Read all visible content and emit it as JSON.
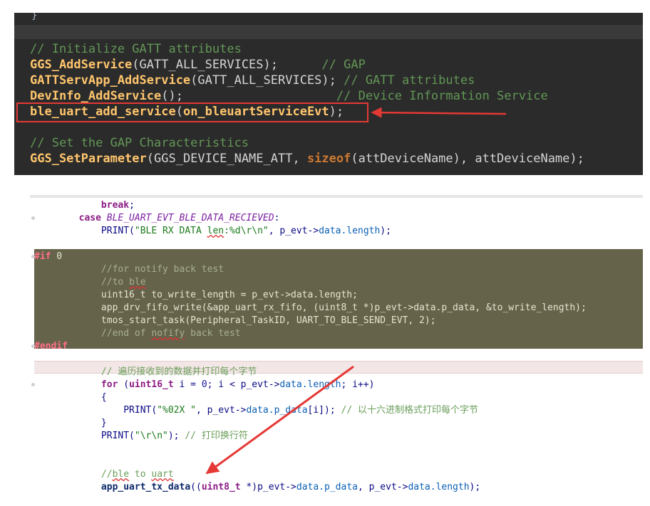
{
  "colors": {
    "highlight_red": "#e53935",
    "arrow_red": "#e53935"
  },
  "panel1": {
    "brace": "}",
    "lines": [
      {
        "segments": [
          {
            "cls": "c-comment",
            "text": "// Initialize GATT attributes"
          }
        ]
      },
      {
        "segments": [
          {
            "cls": "c-fn",
            "text": "GGS_AddService"
          },
          {
            "cls": "c-plain",
            "text": "(GATT_ALL_SERVICES);      "
          },
          {
            "cls": "c-comment",
            "text": "// GAP"
          }
        ]
      },
      {
        "segments": [
          {
            "cls": "c-fn",
            "text": "GATTServApp_AddService"
          },
          {
            "cls": "c-plain",
            "text": "(GATT_ALL_SERVICES); "
          },
          {
            "cls": "c-comment",
            "text": "// GATT attributes"
          }
        ]
      },
      {
        "segments": [
          {
            "cls": "c-fn",
            "text": "DevInfo_AddService"
          },
          {
            "cls": "c-plain",
            "text": "();                     "
          },
          {
            "cls": "c-comment",
            "text": "// Device Information Service"
          }
        ]
      },
      {
        "segments": [
          {
            "cls": "c-fn",
            "text": "ble_uart_add_service"
          },
          {
            "cls": "c-plain",
            "text": "("
          },
          {
            "cls": "c-fn",
            "text": "on_bleuartServiceEvt"
          },
          {
            "cls": "c-plain",
            "text": ");"
          }
        ]
      },
      {
        "segments": [
          {
            "cls": "c-plain",
            "text": ""
          }
        ]
      },
      {
        "segments": [
          {
            "cls": "c-comment",
            "text": "// Set the GAP Characteristics"
          }
        ]
      },
      {
        "segments": [
          {
            "cls": "c-fn",
            "text": "GGS_SetParameter"
          },
          {
            "cls": "c-plain",
            "text": "(GGS_DEVICE_NAME_ATT, "
          },
          {
            "cls": "c-kw",
            "text": "sizeof"
          },
          {
            "cls": "c-plain",
            "text": "(attDeviceName), attDeviceName);"
          }
        ]
      }
    ]
  },
  "panel2": {
    "lines": [
      {
        "dot": false,
        "segments": [
          {
            "cls": "k",
            "text": "            break"
          },
          {
            "cls": "",
            "text": ";"
          }
        ]
      },
      {
        "dot": true,
        "segments": [
          {
            "cls": "k",
            "text": "        case "
          },
          {
            "cls": "enumc",
            "text": "BLE_UART_EVT_BLE_DATA_RECIEVED"
          },
          {
            "cls": "",
            "text": ":"
          }
        ]
      },
      {
        "dot": false,
        "segments": [
          {
            "cls": "",
            "text": "            PRINT("
          },
          {
            "cls": "str",
            "text": "\"BLE RX DATA "
          },
          {
            "cls": "str squig",
            "text": "len"
          },
          {
            "cls": "str",
            "text": ":%d\\r\\n\""
          },
          {
            "cls": "",
            "text": ", p_evt->"
          },
          {
            "cls": "str2",
            "text": "data.length"
          },
          {
            "cls": "",
            "text": ");"
          }
        ]
      },
      {
        "dot": false,
        "segments": [
          {
            "cls": "",
            "text": ""
          }
        ]
      },
      {
        "dot": true,
        "segments": [
          {
            "cls": "dkpp",
            "text": "#if"
          },
          {
            "cls": "dk",
            "text": " 0"
          }
        ]
      },
      {
        "dot": false,
        "segments": [
          {
            "cls": "dkc",
            "text": "            //for notify back test"
          }
        ]
      },
      {
        "dot": false,
        "segments": [
          {
            "cls": "dkc",
            "text": "            //to "
          },
          {
            "cls": "dkc squig",
            "text": "ble"
          }
        ]
      },
      {
        "dot": false,
        "segments": [
          {
            "cls": "dk",
            "text": "            uint16_t to_write_length = p_evt->data.length;"
          }
        ]
      },
      {
        "dot": false,
        "segments": [
          {
            "cls": "dk",
            "text": "            app_drv_fifo_write(&app_uart_rx_fifo, (uint8_t *)p_evt->data.p_data, &to_write_length);"
          }
        ]
      },
      {
        "dot": false,
        "segments": [
          {
            "cls": "dk",
            "text": "            tmos_start_task(Peripheral_TaskID, UART_TO_BLE_SEND_EVT, 2);"
          }
        ]
      },
      {
        "dot": false,
        "segments": [
          {
            "cls": "dkc",
            "text": "            //end of "
          },
          {
            "cls": "dkc squig",
            "text": "nofify"
          },
          {
            "cls": "dkc",
            "text": " back test"
          }
        ]
      },
      {
        "dot": true,
        "segments": [
          {
            "cls": "dkpp",
            "text": "#endif"
          }
        ]
      },
      {
        "dot": false,
        "segments": [
          {
            "cls": "",
            "text": ""
          }
        ]
      },
      {
        "dot": false,
        "segments": [
          {
            "cls": "cmt",
            "text": "            // 遍历接收到的数据并打印每个字节"
          }
        ]
      },
      {
        "dot": true,
        "segments": [
          {
            "cls": "k",
            "text": "            for"
          },
          {
            "cls": "",
            "text": " ("
          },
          {
            "cls": "k",
            "text": "uint16_t"
          },
          {
            "cls": "",
            "text": " i = "
          },
          {
            "cls": "num",
            "text": "0"
          },
          {
            "cls": "",
            "text": "; i < p_evt->"
          },
          {
            "cls": "str2",
            "text": "data.length"
          },
          {
            "cls": "",
            "text": "; i++)"
          }
        ]
      },
      {
        "dot": false,
        "segments": [
          {
            "cls": "",
            "text": "            {"
          }
        ]
      },
      {
        "dot": false,
        "segments": [
          {
            "cls": "",
            "text": "                PRINT("
          },
          {
            "cls": "str",
            "text": "\"%02X \""
          },
          {
            "cls": "",
            "text": ", p_evt->"
          },
          {
            "cls": "str2",
            "text": "data.p_data"
          },
          {
            "cls": "",
            "text": "[i]); "
          },
          {
            "cls": "cmt",
            "text": "// 以十六进制格式打印每个字节"
          }
        ]
      },
      {
        "dot": false,
        "segments": [
          {
            "cls": "",
            "text": "            }"
          }
        ]
      },
      {
        "dot": false,
        "segments": [
          {
            "cls": "",
            "text": "            PRINT("
          },
          {
            "cls": "str",
            "text": "\"\\r\\n\""
          },
          {
            "cls": "",
            "text": "); "
          },
          {
            "cls": "cmt",
            "text": "// 打印换行符"
          }
        ]
      },
      {
        "dot": false,
        "segments": [
          {
            "cls": "",
            "text": ""
          }
        ]
      },
      {
        "dot": false,
        "segments": [
          {
            "cls": "",
            "text": ""
          }
        ]
      },
      {
        "dot": false,
        "segments": [
          {
            "cls": "cmt",
            "text": "            //"
          },
          {
            "cls": "cmt squig",
            "text": "ble"
          },
          {
            "cls": "cmt",
            "text": " to "
          },
          {
            "cls": "cmt squig",
            "text": "uart"
          }
        ]
      },
      {
        "dot": false,
        "segments": [
          {
            "cls": "fnb",
            "text": "            app_uart_tx_data"
          },
          {
            "cls": "",
            "text": "(("
          },
          {
            "cls": "k",
            "text": "uint8_t"
          },
          {
            "cls": "",
            "text": " *)p_evt->"
          },
          {
            "cls": "str2",
            "text": "data.p_data"
          },
          {
            "cls": "",
            "text": ", p_evt->"
          },
          {
            "cls": "str2",
            "text": "data.length"
          },
          {
            "cls": "",
            "text": ");"
          }
        ]
      }
    ]
  }
}
